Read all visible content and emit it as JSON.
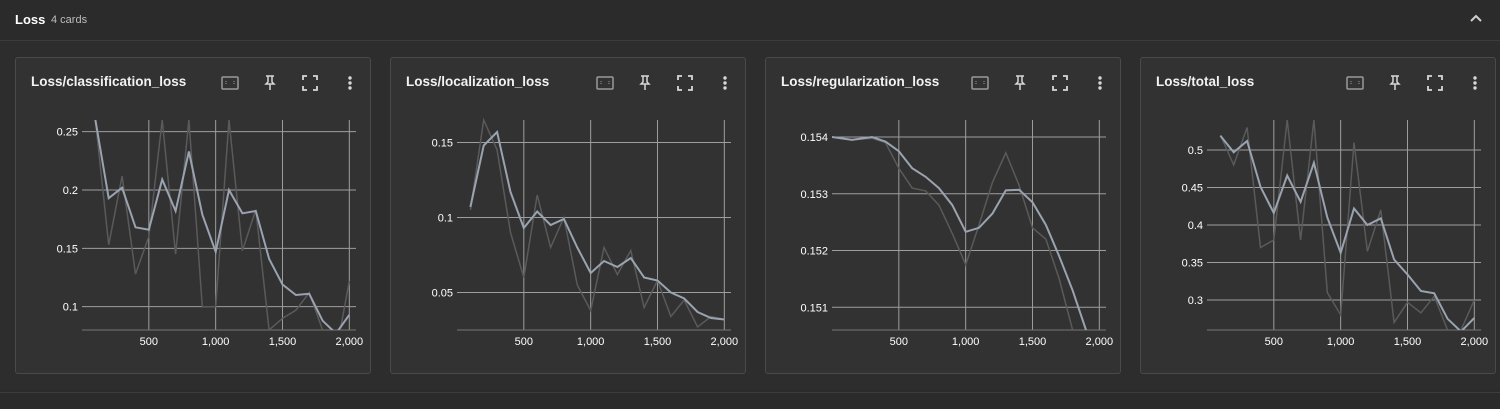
{
  "group": {
    "title": "Loss",
    "count_label": "4 cards",
    "collapse_icon": "chevron-up-icon"
  },
  "card_buttons": [
    "fit-domain-icon",
    "pin-icon",
    "fullscreen-icon",
    "more-vert-icon"
  ],
  "theme": {
    "smoothed": "#9aa3b0",
    "raw": "#5a5a5a",
    "grid": "#9e9e9e",
    "axis_text": "#ffffff"
  },
  "chart_data": [
    {
      "type": "line",
      "title": "Loss/classification_loss",
      "xlim": [
        0,
        2050
      ],
      "ylim": [
        0.08,
        0.26
      ],
      "xticks": [
        500,
        1000,
        1500,
        2000
      ],
      "xtick_labels": [
        "500",
        "1,000",
        "1,500",
        "2,000"
      ],
      "yticks": [
        0.1,
        0.15,
        0.2,
        0.25
      ],
      "ytick_labels": [
        "0.1",
        "0.15",
        "0.2",
        "0.25"
      ],
      "grid": true,
      "series": [
        {
          "role": "raw",
          "x": [
            100,
            200,
            300,
            400,
            500,
            600,
            700,
            800,
            900,
            1000,
            1100,
            1200,
            1300,
            1400,
            1500,
            1600,
            1700,
            1800,
            1900,
            2000
          ],
          "y": [
            0.26,
            0.153,
            0.212,
            0.128,
            0.16,
            0.26,
            0.145,
            0.26,
            0.1,
            0.1,
            0.26,
            0.148,
            0.183,
            0.08,
            0.09,
            0.097,
            0.112,
            0.08,
            0.06,
            0.122
          ]
        },
        {
          "role": "smoothed",
          "x": [
            100,
            200,
            300,
            400,
            500,
            600,
            700,
            800,
            900,
            1000,
            1100,
            1200,
            1300,
            1400,
            1500,
            1600,
            1700,
            1800,
            1900,
            2000
          ],
          "y": [
            0.26,
            0.193,
            0.202,
            0.168,
            0.166,
            0.209,
            0.182,
            0.233,
            0.179,
            0.147,
            0.2,
            0.18,
            0.182,
            0.141,
            0.119,
            0.11,
            0.111,
            0.088,
            0.077,
            0.093
          ]
        }
      ]
    },
    {
      "type": "line",
      "title": "Loss/localization_loss",
      "xlim": [
        0,
        2050
      ],
      "ylim": [
        0.025,
        0.165
      ],
      "xticks": [
        500,
        1000,
        1500,
        2000
      ],
      "xtick_labels": [
        "500",
        "1,000",
        "1,500",
        "2,000"
      ],
      "yticks": [
        0.05,
        0.1,
        0.15
      ],
      "yticks_labels_note": "",
      "ytick_labels": [
        "0.05",
        "0.1",
        "0.15"
      ],
      "grid": true,
      "series": [
        {
          "role": "raw",
          "x": [
            100,
            200,
            300,
            400,
            500,
            600,
            700,
            800,
            900,
            1000,
            1100,
            1200,
            1300,
            1400,
            1500,
            1600,
            1700,
            1800,
            1900,
            2000
          ],
          "y": [
            0.105,
            0.165,
            0.145,
            0.09,
            0.06,
            0.115,
            0.08,
            0.1,
            0.055,
            0.038,
            0.08,
            0.062,
            0.078,
            0.04,
            0.058,
            0.034,
            0.045,
            0.027,
            0.034,
            0.032
          ]
        },
        {
          "role": "smoothed",
          "x": [
            100,
            200,
            300,
            400,
            500,
            600,
            700,
            800,
            900,
            1000,
            1100,
            1200,
            1300,
            1400,
            1500,
            1600,
            1700,
            1800,
            1900,
            2000
          ],
          "y": [
            0.107,
            0.148,
            0.157,
            0.117,
            0.093,
            0.104,
            0.095,
            0.099,
            0.08,
            0.063,
            0.071,
            0.067,
            0.073,
            0.06,
            0.058,
            0.05,
            0.046,
            0.037,
            0.033,
            0.032
          ]
        }
      ]
    },
    {
      "type": "line",
      "title": "Loss/regularization_loss",
      "xlim": [
        0,
        2050
      ],
      "ylim": [
        0.1506,
        0.1543
      ],
      "xticks": [
        500,
        1000,
        1500,
        2000
      ],
      "xtick_labels": [
        "500",
        "1,000",
        "1,500",
        "2,000"
      ],
      "yticks": [
        0.151,
        0.152,
        0.153,
        0.154
      ],
      "ytick_labels": [
        "0.151",
        "0.152",
        "0.153",
        "0.154"
      ],
      "grid": true,
      "series": [
        {
          "role": "raw",
          "x": [
            0,
            150,
            300,
            400,
            500,
            600,
            700,
            800,
            900,
            1000,
            1100,
            1200,
            1300,
            1400,
            1500,
            1600,
            1700,
            1800
          ],
          "y": [
            0.154,
            0.15395,
            0.15398,
            0.1539,
            0.15345,
            0.1531,
            0.15305,
            0.1528,
            0.1523,
            0.15175,
            0.15245,
            0.1532,
            0.15372,
            0.15315,
            0.1524,
            0.1522,
            0.1515,
            0.1506
          ]
        },
        {
          "role": "smoothed",
          "x": [
            0,
            150,
            300,
            400,
            500,
            600,
            700,
            800,
            900,
            1000,
            1100,
            1200,
            1300,
            1400,
            1500,
            1600,
            1700,
            1800,
            1900
          ],
          "y": [
            0.154,
            0.15395,
            0.154,
            0.15392,
            0.15375,
            0.15345,
            0.1533,
            0.1531,
            0.1528,
            0.15233,
            0.1524,
            0.15265,
            0.15306,
            0.15307,
            0.15285,
            0.15245,
            0.1519,
            0.1513,
            0.1506
          ]
        }
      ]
    },
    {
      "type": "line",
      "title": "Loss/total_loss",
      "xlim": [
        0,
        2050
      ],
      "ylim": [
        0.26,
        0.54
      ],
      "xticks": [
        500,
        1000,
        1500,
        2000
      ],
      "xtick_labels": [
        "500",
        "1,000",
        "1,500",
        "2,000"
      ],
      "yticks": [
        0.3,
        0.35,
        0.4,
        0.45,
        0.5
      ],
      "ytick_labels": [
        "0.3",
        "0.35",
        "0.4",
        "0.45",
        "0.5"
      ],
      "grid": true,
      "series": [
        {
          "role": "raw",
          "x": [
            100,
            200,
            300,
            400,
            500,
            600,
            700,
            800,
            900,
            1000,
            1100,
            1200,
            1300,
            1400,
            1500,
            1600,
            1700,
            1800,
            1900,
            2000
          ],
          "y": [
            0.52,
            0.48,
            0.53,
            0.37,
            0.38,
            0.54,
            0.38,
            0.54,
            0.31,
            0.28,
            0.51,
            0.365,
            0.42,
            0.27,
            0.297,
            0.283,
            0.305,
            0.26,
            0.26,
            0.3
          ]
        },
        {
          "role": "smoothed",
          "x": [
            100,
            200,
            300,
            400,
            500,
            600,
            700,
            800,
            900,
            1000,
            1100,
            1200,
            1300,
            1400,
            1500,
            1600,
            1700,
            1800,
            1900,
            2000
          ],
          "y": [
            0.519,
            0.497,
            0.512,
            0.451,
            0.416,
            0.466,
            0.431,
            0.483,
            0.41,
            0.363,
            0.422,
            0.4,
            0.409,
            0.354,
            0.334,
            0.312,
            0.309,
            0.275,
            0.258,
            0.276
          ]
        }
      ]
    }
  ]
}
